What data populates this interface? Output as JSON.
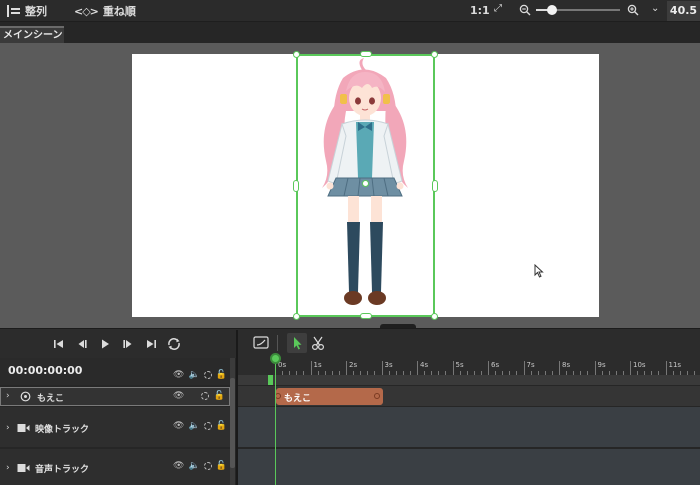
{
  "toolbar": {
    "align_label": "整列",
    "order_label": "重ね順",
    "ratio_label": "1:1",
    "zoom_fraction": 0.19,
    "zoom_value": "40.5"
  },
  "scene_tab": {
    "label": "メインシーン"
  },
  "playback": {
    "buttons": [
      "skip-to-start",
      "step-back",
      "play",
      "step-forward",
      "skip-to-end",
      "loop"
    ]
  },
  "timecode": "00:00:00:00",
  "ruler": {
    "labels": [
      "0s",
      "1s",
      "2s",
      "3s",
      "4s",
      "5s",
      "6s",
      "7s",
      "8s",
      "9s",
      "10s",
      "11s"
    ]
  },
  "tracks": [
    {
      "label": "もえこ",
      "icon": "character-icon",
      "selected": true
    },
    {
      "label": "映像トラック",
      "icon": "video-track-icon",
      "selected": false
    },
    {
      "label": "音声トラック",
      "icon": "audio-track-icon",
      "selected": false
    }
  ],
  "clip": {
    "label": "もえこ"
  },
  "colors": {
    "accent_green": "#5ac85a",
    "clip_orange": "#b4694a",
    "preview_bg": "#5b5b5b"
  }
}
